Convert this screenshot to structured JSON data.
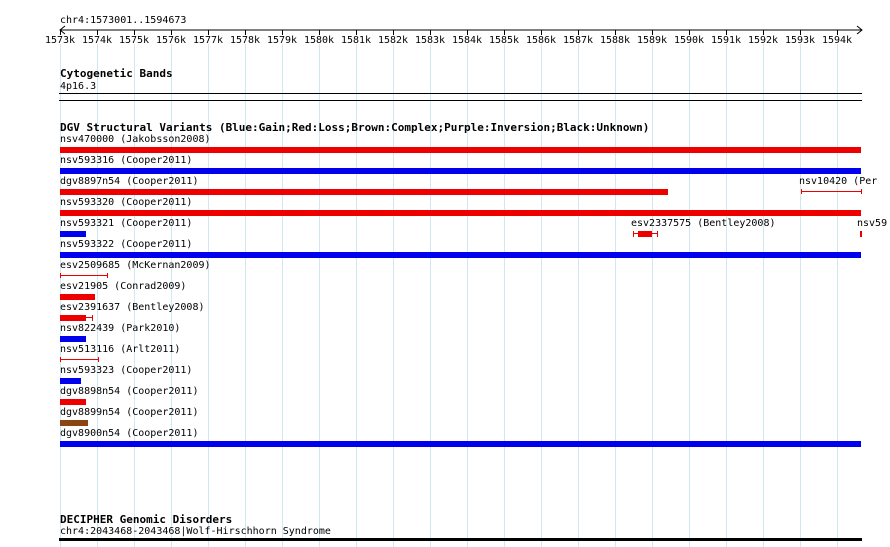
{
  "ruler": {
    "location": "chr4:1573001..1594673",
    "ticks": [
      "1573k",
      "1574k",
      "1575k",
      "1576k",
      "1577k",
      "1578k",
      "1579k",
      "1580k",
      "1581k",
      "1582k",
      "1583k",
      "1584k",
      "1585k",
      "1586k",
      "1587k",
      "1588k",
      "1589k",
      "1590k",
      "1591k",
      "1592k",
      "1593k",
      "1594k"
    ]
  },
  "tracks": {
    "cytoband": {
      "title": "Cytogenetic Bands",
      "band_label": "4p16.3"
    },
    "dgv": {
      "title": "DGV Structural Variants (Blue:Gain;Red:Loss;Brown:Complex;Purple:Inversion;Black:Unknown)",
      "colors": {
        "gain": "#0000ee",
        "loss": "#ee0000",
        "complex": "#8b4513"
      },
      "features": [
        {
          "id": "nsv470000",
          "label": "nsv470000 (Jakobsson2008)",
          "type": "loss",
          "start_kb": 1573.0,
          "end_kb": 1594.673,
          "style": "bar",
          "row": 0
        },
        {
          "id": "nsv593316",
          "label": "nsv593316 (Cooper2011)",
          "type": "gain",
          "start_kb": 1573.0,
          "end_kb": 1594.673,
          "style": "bar",
          "row": 1
        },
        {
          "id": "dgv8897n54",
          "label": "dgv8897n54 (Cooper2011)",
          "type": "loss",
          "start_kb": 1573.0,
          "end_kb": 1589.45,
          "style": "bar",
          "row": 2
        },
        {
          "id": "nsv10420",
          "label": "nsv10420 (Per",
          "type": "loss",
          "start_kb": 1593.05,
          "end_kb": 1594.673,
          "style": "thin",
          "row": 2
        },
        {
          "id": "nsv593320",
          "label": "nsv593320 (Cooper2011)",
          "type": "loss",
          "start_kb": 1573.0,
          "end_kb": 1594.673,
          "style": "bar",
          "row": 3
        },
        {
          "id": "nsv593321",
          "label": "nsv593321 (Cooper2011)",
          "type": "gain",
          "start_kb": 1573.0,
          "end_kb": 1573.72,
          "style": "bar",
          "row": 4
        },
        {
          "id": "esv2337575",
          "label": "esv2337575 (Bentley2008)",
          "type": "loss",
          "start_kb": 1588.5,
          "end_kb": 1589.15,
          "style": "capped",
          "row": 4
        },
        {
          "id": "nsv59",
          "label": "nsv59",
          "type": "loss",
          "start_kb": 1594.6,
          "end_kb": 1594.673,
          "style": "cap",
          "row": 4
        },
        {
          "id": "nsv593322",
          "label": "nsv593322 (Cooper2011)",
          "type": "gain",
          "start_kb": 1573.0,
          "end_kb": 1594.673,
          "style": "bar",
          "row": 5
        },
        {
          "id": "esv2509685",
          "label": "esv2509685 (McKernan2009)",
          "type": "loss",
          "start_kb": 1573.0,
          "end_kb": 1574.28,
          "style": "thin",
          "row": 6
        },
        {
          "id": "esv21905",
          "label": "esv21905 (Conrad2009)",
          "type": "loss",
          "start_kb": 1573.0,
          "end_kb": 1573.95,
          "style": "bar",
          "row": 7
        },
        {
          "id": "esv2391637",
          "label": "esv2391637 (Bentley2008)",
          "type": "loss",
          "start_kb": 1573.0,
          "end_kb": 1573.88,
          "style": "capped-right",
          "row": 8
        },
        {
          "id": "nsv822439",
          "label": "nsv822439 (Park2010)",
          "type": "gain",
          "start_kb": 1573.0,
          "end_kb": 1573.72,
          "style": "bar",
          "row": 9
        },
        {
          "id": "nsv513116",
          "label": "nsv513116 (Arlt2011)",
          "type": "loss",
          "start_kb": 1573.0,
          "end_kb": 1574.05,
          "style": "thin",
          "row": 10
        },
        {
          "id": "nsv593323",
          "label": "nsv593323 (Cooper2011)",
          "type": "gain",
          "start_kb": 1573.0,
          "end_kb": 1573.57,
          "style": "bar",
          "row": 11
        },
        {
          "id": "dgv8898n54",
          "label": "dgv8898n54 (Cooper2011)",
          "type": "loss",
          "start_kb": 1573.0,
          "end_kb": 1573.72,
          "style": "bar",
          "row": 12
        },
        {
          "id": "dgv8899n54",
          "label": "dgv8899n54 (Cooper2011)",
          "type": "complex",
          "start_kb": 1573.0,
          "end_kb": 1573.76,
          "style": "bar",
          "row": 13
        },
        {
          "id": "dgv8900n54",
          "label": "dgv8900n54 (Cooper2011)",
          "type": "gain",
          "start_kb": 1573.0,
          "end_kb": 1594.673,
          "style": "bar",
          "row": 14
        }
      ]
    },
    "decipher": {
      "title": "DECIPHER Genomic Disorders",
      "label": "chr4:2043468-2043468|Wolf-Hirschhorn Syndrome"
    }
  }
}
